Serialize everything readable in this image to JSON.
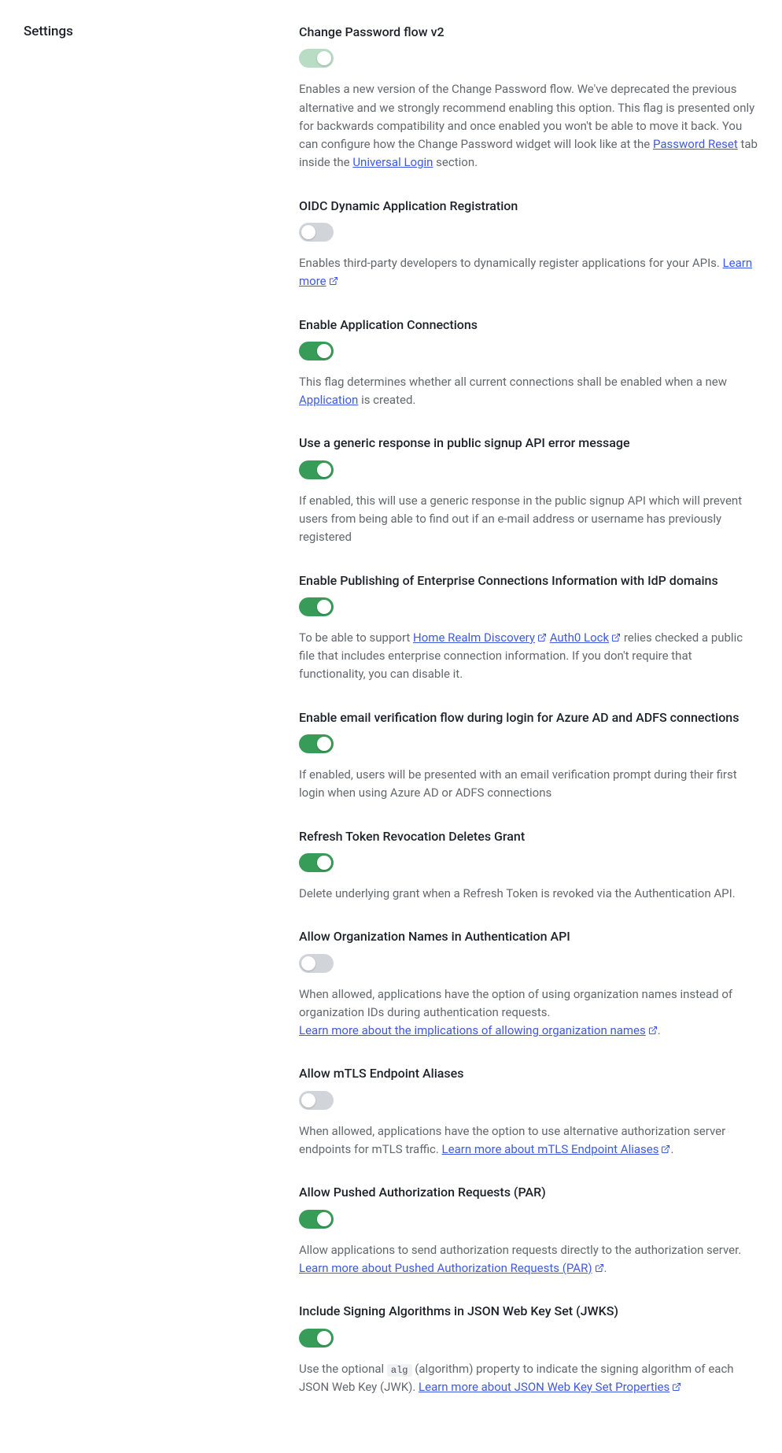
{
  "sidebar": {
    "title": "Settings"
  },
  "settings": [
    {
      "title": "Change Password flow v2",
      "state": "on-disabled",
      "desc_parts": [
        {
          "t": "text",
          "v": "Enables a new version of the Change Password flow. We've deprecated the previous alternative and we strongly recommend enabling this option. This flag is presented only for backwards compatibility and once enabled you won't be able to move it back. You can configure how the Change Password widget will look like at the "
        },
        {
          "t": "link",
          "v": "Password Reset"
        },
        {
          "t": "text",
          "v": " tab inside the "
        },
        {
          "t": "link",
          "v": "Universal Login"
        },
        {
          "t": "text",
          "v": " section."
        }
      ]
    },
    {
      "title": "OIDC Dynamic Application Registration",
      "state": "off",
      "desc_parts": [
        {
          "t": "text",
          "v": "Enables third-party developers to dynamically register applications for your APIs. "
        },
        {
          "t": "link-ext",
          "v": "Learn more"
        }
      ]
    },
    {
      "title": "Enable Application Connections",
      "state": "on",
      "desc_parts": [
        {
          "t": "text",
          "v": "This flag determines whether all current connections shall be enabled when a new "
        },
        {
          "t": "link",
          "v": "Application"
        },
        {
          "t": "text",
          "v": " is created."
        }
      ]
    },
    {
      "title": "Use a generic response in public signup API error message",
      "state": "on",
      "desc_parts": [
        {
          "t": "text",
          "v": "If enabled, this will use a generic response in the public signup API which will prevent users from being able to find out if an e-mail address or username has previously registered"
        }
      ]
    },
    {
      "title": "Enable Publishing of Enterprise Connections Information with IdP domains",
      "state": "on",
      "desc_parts": [
        {
          "t": "text",
          "v": "To be able to support "
        },
        {
          "t": "link-ext",
          "v": "Home Realm Discovery"
        },
        {
          "t": "text",
          "v": " "
        },
        {
          "t": "link-ext",
          "v": "Auth0 Lock"
        },
        {
          "t": "text",
          "v": " relies checked a public file that includes enterprise connection information. If you don't require that functionality, you can disable it."
        }
      ]
    },
    {
      "title": "Enable email verification flow during login for Azure AD and ADFS connections",
      "state": "on",
      "desc_parts": [
        {
          "t": "text",
          "v": "If enabled, users will be presented with an email verification prompt during their first login when using Azure AD or ADFS connections"
        }
      ]
    },
    {
      "title": "Refresh Token Revocation Deletes Grant",
      "state": "on",
      "desc_parts": [
        {
          "t": "text",
          "v": "Delete underlying grant when a Refresh Token is revoked via the Authentication API."
        }
      ]
    },
    {
      "title": "Allow Organization Names in Authentication API",
      "state": "off",
      "desc_parts": [
        {
          "t": "text",
          "v": "When allowed, applications have the option of using organization names instead of organization IDs during authentication requests."
        },
        {
          "t": "br"
        },
        {
          "t": "link-ext",
          "v": "Learn more about the implications of allowing organization names"
        },
        {
          "t": "text",
          "v": "."
        }
      ]
    },
    {
      "title": "Allow mTLS Endpoint Aliases",
      "state": "off",
      "desc_parts": [
        {
          "t": "text",
          "v": "When allowed, applications have the option to use alternative authorization server endpoints for mTLS traffic. "
        },
        {
          "t": "link-ext",
          "v": "Learn more about mTLS Endpoint Aliases"
        },
        {
          "t": "text",
          "v": "."
        }
      ]
    },
    {
      "title": "Allow Pushed Authorization Requests (PAR)",
      "state": "on",
      "desc_parts": [
        {
          "t": "text",
          "v": "Allow applications to send authorization requests directly to the authorization server. "
        },
        {
          "t": "link-ext",
          "v": "Learn more about Pushed Authorization Requests (PAR)"
        },
        {
          "t": "text",
          "v": "."
        }
      ]
    },
    {
      "title": "Include Signing Algorithms in JSON Web Key Set (JWKS)",
      "state": "on",
      "desc_parts": [
        {
          "t": "text",
          "v": "Use the optional "
        },
        {
          "t": "code",
          "v": "alg"
        },
        {
          "t": "text",
          "v": " (algorithm) property to indicate the signing algorithm of each JSON Web Key (JWK). "
        },
        {
          "t": "link-ext",
          "v": "Learn more about JSON Web Key Set Properties"
        }
      ]
    }
  ]
}
